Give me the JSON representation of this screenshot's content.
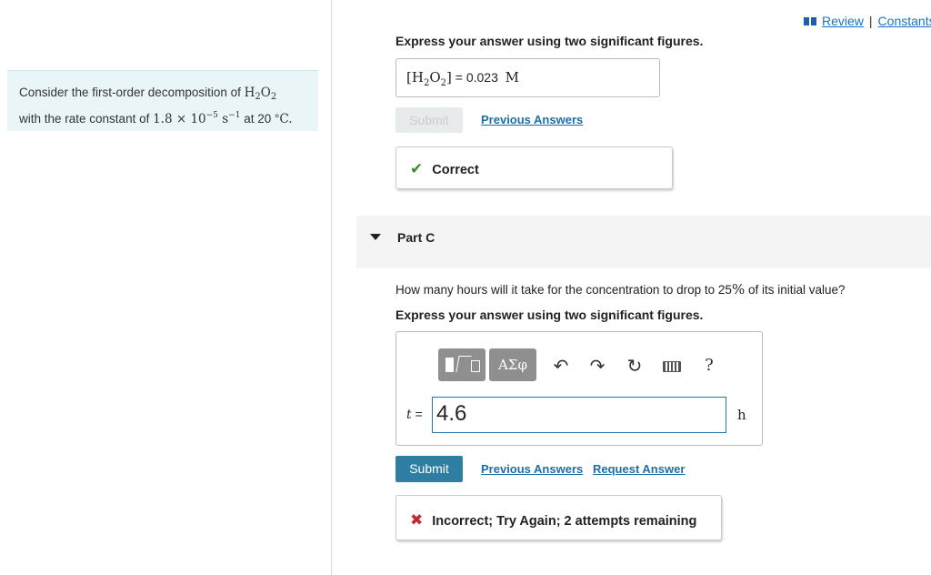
{
  "colors": {
    "accent_blue": "#2e7ea3",
    "link_blue": "#1e6ea8",
    "problem_bg": "#eaf5f7",
    "correct_green": "#3c8c2c",
    "incorrect_red": "#c8282d"
  },
  "top_links": {
    "review": "Review",
    "separator": "|",
    "constants": "Constants",
    "icon": "book-icon"
  },
  "problem": {
    "text_1": "Consider the first-order decomposition of ",
    "species": "H",
    "species_sub1": "2",
    "species_o": "O",
    "species_sub2": "2",
    "text_2": "with the rate constant of ",
    "rate_mantissa": "1.8 × 10",
    "rate_exp": "−5",
    "rate_unit": " s",
    "rate_unit_exp": "−1",
    "text_3": " at 20 °",
    "temp_unit": "C."
  },
  "part_b": {
    "instruction": "Express your answer using two significant figures.",
    "answer_label_open": "[H",
    "answer_label_sub1": "2",
    "answer_label_o": "O",
    "answer_label_sub2": "2",
    "answer_label_close": "]",
    "equals": " = ",
    "answer_value": "0.023",
    "answer_unit": "M",
    "submit_label": "Submit",
    "previous_answers": "Previous Answers",
    "feedback": "Correct",
    "feedback_icon": "check-icon"
  },
  "part_c": {
    "title": "Part C",
    "question_1": "How many hours will it take for the concentration to drop to 25",
    "question_pct": "%",
    "question_2": " of its initial value?",
    "instruction": "Express your answer using two significant figures.",
    "toolbar": {
      "templates_icon": "fraction-sqrt-template-icon",
      "greek_label": "ΑΣφ",
      "undo_icon": "undo-icon",
      "redo_icon": "redo-icon",
      "reset_icon": "reset-icon",
      "keyboard_icon": "keyboard-icon",
      "help_label": "?"
    },
    "variable": "t",
    "equals": " =",
    "input_value": "4.6",
    "unit": "h",
    "submit_label": "Submit",
    "previous_answers": "Previous Answers",
    "request_answer": "Request Answer",
    "feedback": "Incorrect; Try Again; 2 attempts remaining",
    "feedback_icon": "cross-icon"
  }
}
